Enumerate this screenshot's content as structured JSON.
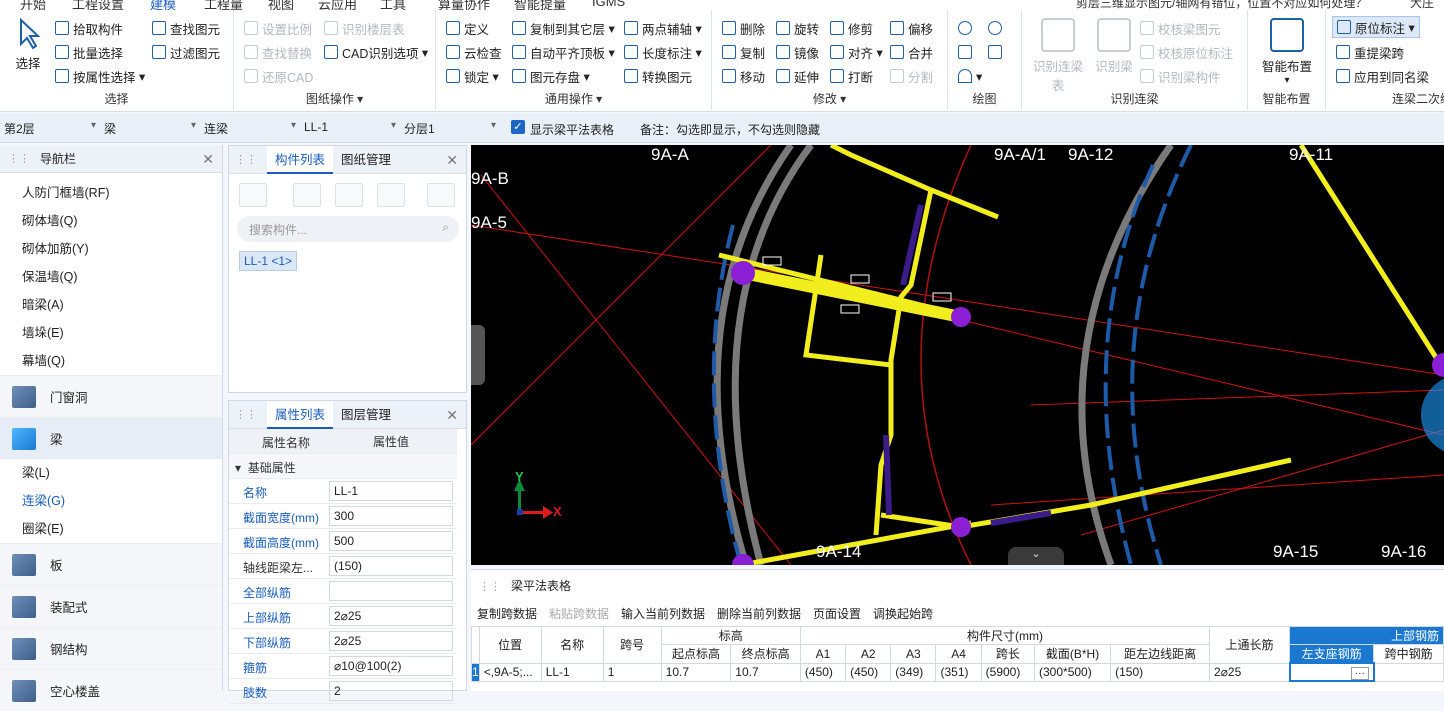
{
  "top_tabs": [
    "开始",
    "工程设置",
    "建模",
    "工程量",
    "视图",
    "云应用",
    "工具",
    "算量协作",
    "智能提量",
    "IGMS"
  ],
  "top_right_text": "剪层三维显示图元/轴网有错位，位置不对应如何处理？",
  "user_label": "大庄",
  "ribbon": {
    "select": {
      "label": "选择",
      "pick": "拾取构件",
      "batch": "批量选择",
      "by_attr": "按属性选择",
      "find": "查找图元",
      "filter": "过滤图元",
      "title": "选择"
    },
    "drawing": {
      "scale": "设置比例",
      "find_replace": "查找替换",
      "restore_cad": "还原CAD",
      "recognize_floor": "识别楼层表",
      "cad_options": "CAD识别选项",
      "title": "图纸操作"
    },
    "general": {
      "define": "定义",
      "copy_floor": "复制到其它层",
      "two_point_axis": "两点辅轴",
      "cloud_check": "云检查",
      "auto_align": "自动平齐顶板",
      "length_dim": "长度标注",
      "lock": "锁定",
      "elem_save": "图元存盘",
      "convert": "转换图元",
      "title": "通用操作"
    },
    "modify": {
      "delete": "删除",
      "rotate": "旋转",
      "trim": "修剪",
      "offset": "偏移",
      "copy": "复制",
      "mirror": "镜像",
      "align": "对齐",
      "merge": "合并",
      "move": "移动",
      "extend": "延伸",
      "break": "打断",
      "split": "分割",
      "title": "修改"
    },
    "draw": {
      "title": "绘图"
    },
    "recognize_lintel": {
      "rec_table": "识别连梁表",
      "rec_beam": "识别梁",
      "verify_fig": "校核梁图元",
      "verify_orig": "校核原位标注",
      "rec_comp": "识别梁构件",
      "title": "识别连梁"
    },
    "smart": {
      "label": "智能布置",
      "title": "智能布置"
    },
    "lintel_second": {
      "orig_dim": "原位标注",
      "re_span": "重提梁跨",
      "apply_same": "应用到同名梁",
      "title": "连梁二次编辑"
    }
  },
  "filter": {
    "floor": "第2层",
    "type": "梁",
    "subtype": "连梁",
    "comp": "LL-1",
    "layer": "分层1",
    "show_table": "显示梁平法表格",
    "note": "备注：勾选即显示，不勾选则隐藏"
  },
  "nav": {
    "title": "导航栏",
    "items_top": [
      "人防门框墙(RF)",
      "砌体墙(Q)",
      "砌体加筋(Y)",
      "保温墙(Q)",
      "暗梁(A)",
      "墙垛(E)",
      "幕墙(Q)"
    ],
    "cat_door": "门窗洞",
    "cat_beam": "梁",
    "beam_items": [
      "梁(L)",
      "连梁(G)",
      "圈梁(E)"
    ],
    "cats_bottom": [
      "板",
      "装配式",
      "钢结构",
      "空心楼盖"
    ]
  },
  "complist": {
    "tab1": "构件列表",
    "tab2": "图纸管理",
    "search": "搜索构件...",
    "chip": "LL-1 <1>"
  },
  "props": {
    "tab1": "属性列表",
    "tab2": "图层管理",
    "col_name": "属性名称",
    "col_val": "属性值",
    "section": "基础属性",
    "rows": [
      {
        "n": "名称",
        "v": "LL-1"
      },
      {
        "n": "截面宽度(mm)",
        "v": "300"
      },
      {
        "n": "截面高度(mm)",
        "v": "500"
      },
      {
        "n": "轴线距梁左...",
        "v": "(150)"
      },
      {
        "n": "全部纵筋",
        "v": ""
      },
      {
        "n": "上部纵筋",
        "v": "2⌀25"
      },
      {
        "n": "下部纵筋",
        "v": "2⌀25"
      },
      {
        "n": "箍筋",
        "v": "⌀10@100(2)"
      },
      {
        "n": "肢数",
        "v": "2"
      }
    ]
  },
  "canvas_labels": [
    "9A-A",
    "9A-A/1",
    "9A-12",
    "9A-11",
    "9A-B",
    "9A-5",
    "9A-14",
    "9A-15",
    "9A-16"
  ],
  "axis": {
    "x": "X",
    "y": "Y"
  },
  "bottom": {
    "title": "梁平法表格",
    "actions": [
      "复制跨数据",
      "粘贴跨数据",
      "输入当前列数据",
      "删除当前列数据",
      "页面设置",
      "调换起始跨"
    ],
    "headers": {
      "pos": "位置",
      "name": "名称",
      "span": "跨号",
      "elev": "标高",
      "elev_start": "起点标高",
      "elev_end": "终点标高",
      "size": "构件尺寸(mm)",
      "a1": "A1",
      "a2": "A2",
      "a3": "A3",
      "a4": "A4",
      "span_len": "跨长",
      "section": "截面(B*H)",
      "dist": "距左边线距离",
      "top_long": "上通长筋",
      "top_steel": "上部钢筋",
      "left_seat": "左支座钢筋",
      "mid": "跨中钢筋"
    },
    "row": {
      "idx": "1",
      "pos": "<,9A-5;...",
      "name": "LL-1",
      "span": "1",
      "elev_start": "10.7",
      "elev_end": "10.7",
      "a1": "(450)",
      "a2": "(450)",
      "a3": "(349)",
      "a4": "(351)",
      "span_len": "(5900)",
      "section": "(300*500)",
      "dist": "(150)",
      "top_long": "2⌀25"
    }
  }
}
